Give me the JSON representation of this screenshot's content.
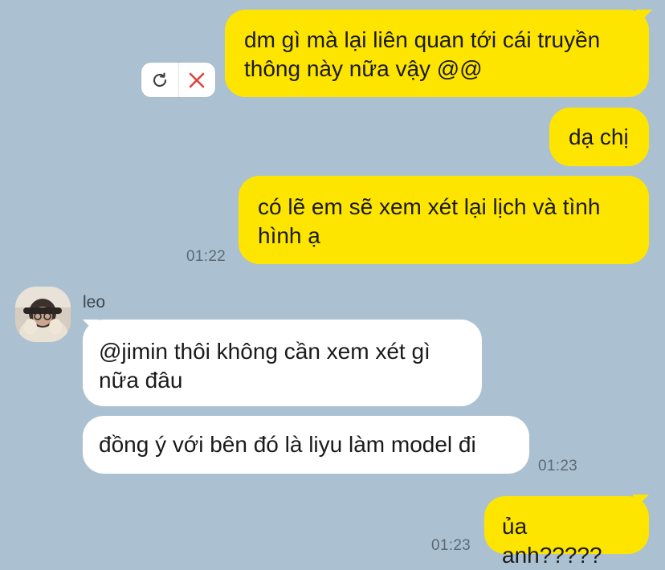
{
  "messages": {
    "m1": {
      "text": "dm gì mà lại liên quan tới cái truyền\nthông này nữa vậy @@"
    },
    "m2": {
      "text": "dạ chị"
    },
    "m3": {
      "text": "có lẽ em sẽ xem xét lại lịch và tình\nhình ạ",
      "time": "01:22"
    },
    "m4": {
      "sender": "leo",
      "text": "@jimin thôi không cần xem xét gì\nnữa đâu"
    },
    "m5": {
      "text": "đồng ý với bên đó là liyu làm model đi",
      "time": "01:23"
    },
    "m6": {
      "text": "ủa anh?????",
      "time": "01:23"
    }
  },
  "failed_actions": {
    "retry_icon": "refresh-icon",
    "delete_icon": "close-icon"
  },
  "colors": {
    "background": "#abc1d1",
    "outgoing_bubble": "#fee500",
    "incoming_bubble": "#ffffff",
    "delete_red": "#e0433b"
  }
}
